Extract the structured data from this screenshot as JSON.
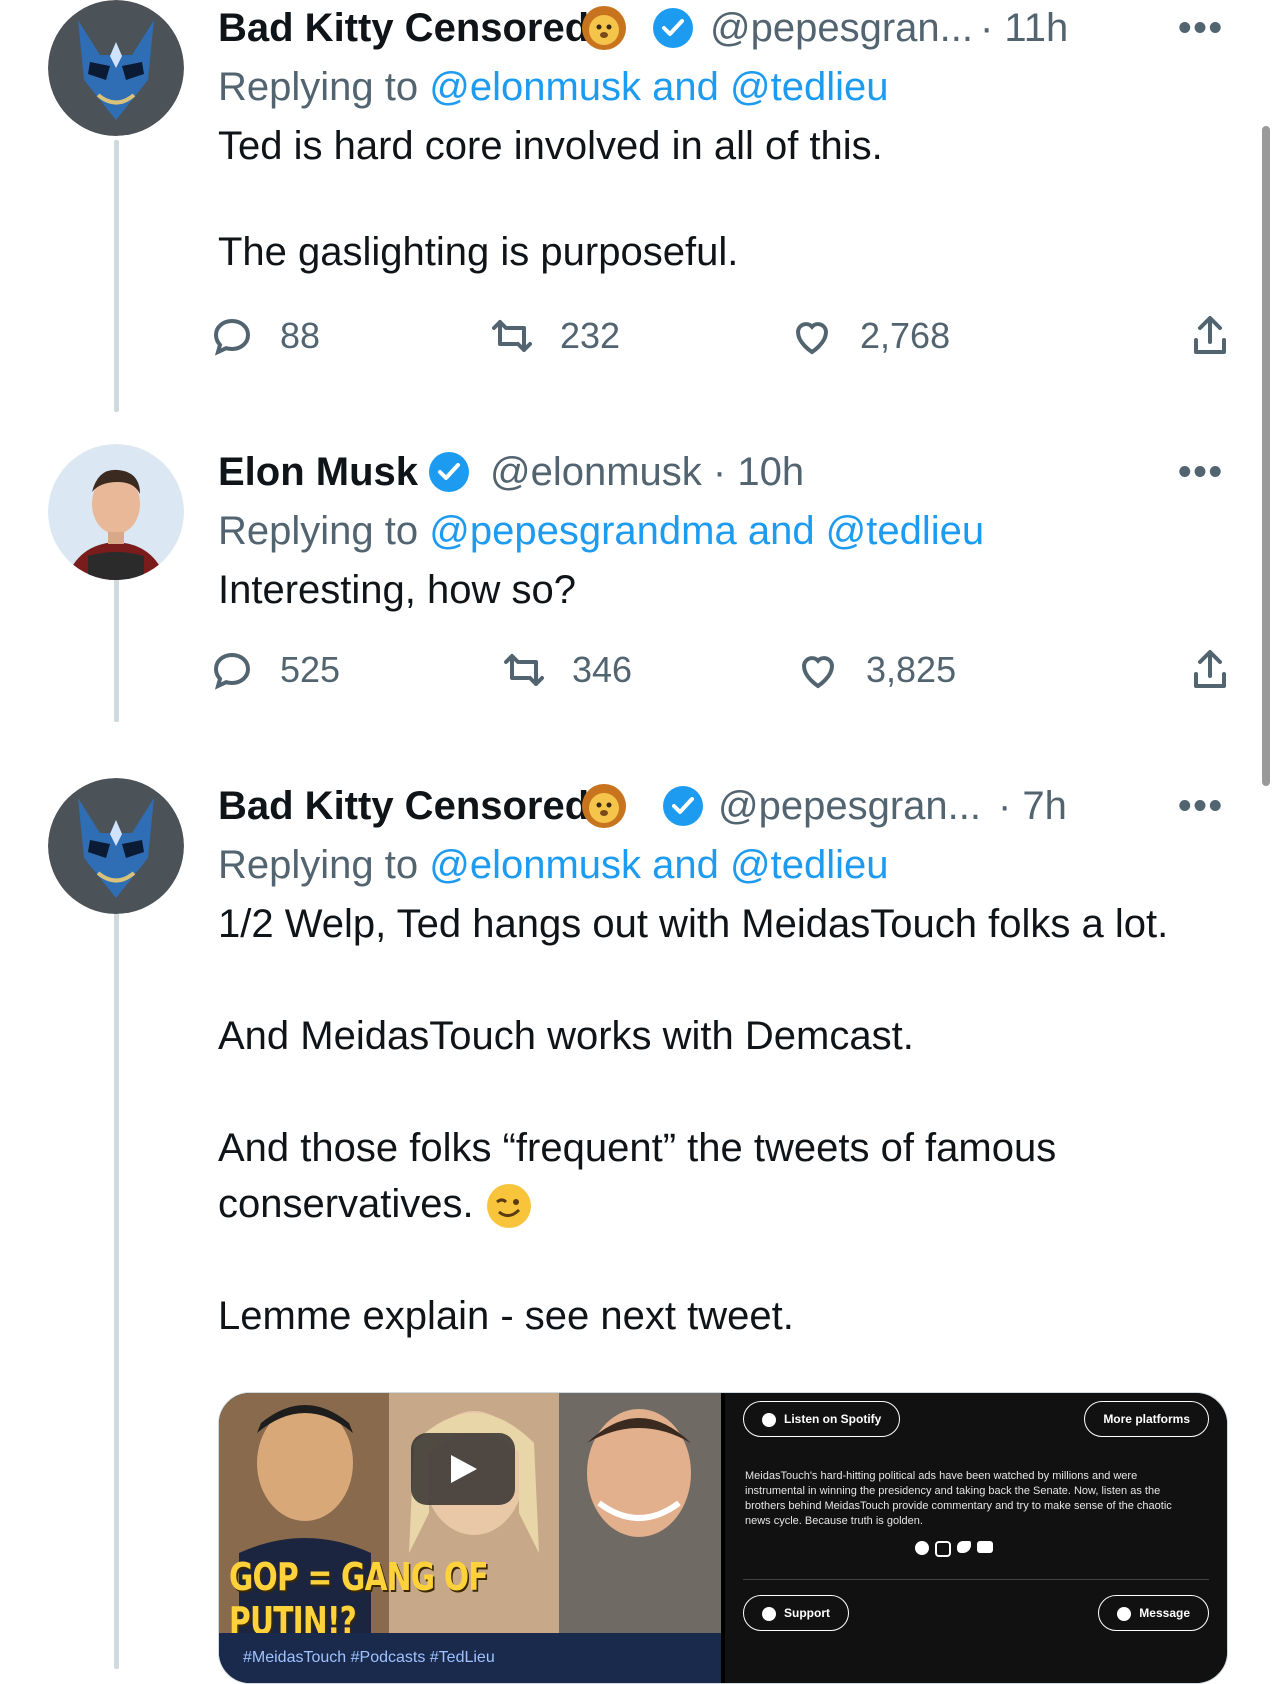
{
  "tweets": [
    {
      "name": "Bad Kitty Censored",
      "handle": "@pepesgran...",
      "time": "· 11h",
      "more": "•••",
      "replying_prefix": "Replying to",
      "replying_mentions": "@elonmusk and @tedlieu",
      "body": [
        "Ted is hard core involved in all of this.",
        "The gaslighting is purposeful."
      ],
      "replies": "88",
      "retweets": "232",
      "likes": "2,768"
    },
    {
      "name": "Elon Musk",
      "handle": "@elonmusk · 10h",
      "more": "•••",
      "replying_prefix": "Replying to",
      "replying_mentions": "@pepesgrandma and @tedlieu",
      "body": [
        "Interesting, how so?"
      ],
      "replies": "525",
      "retweets": "346",
      "likes": "3,825"
    },
    {
      "name": "Bad Kitty Censored",
      "handle": "@pepesgran...",
      "time": "· 7h",
      "more": "•••",
      "replying_prefix": "Replying to",
      "replying_mentions": "@elonmusk and @tedlieu",
      "body": [
        "1/2 Welp, Ted hangs out with MeidasTouch folks a lot.",
        "And MeidasTouch works with Demcast.",
        "And those folks “frequent” the tweets of famous conservatives. ",
        "Lemme explain - see next tweet."
      ]
    }
  ],
  "card": {
    "video_title": "GOP = GANG OF PUTIN!?",
    "tags": "#MeidasTouch   #Podcasts   #TedLieu",
    "listen": "Listen on Spotify",
    "more_platforms": "More platforms",
    "description": "MeidasTouch's hard-hitting political ads have been watched by millions and were instrumental in winning the presidency and taking back the Senate. Now, listen as the brothers behind MeidasTouch provide commentary and try to make sense of the chaotic news cycle. Because truth is golden.",
    "support": "Support",
    "message": "Message"
  },
  "colors": {
    "link": "#1d9bf0",
    "secondary": "#536471",
    "verified": "#1d9bf0"
  },
  "icons": [
    "reply-icon",
    "retweet-icon",
    "like-icon",
    "share-icon",
    "verified-badge-icon",
    "lion-emoji",
    "wink-emoji",
    "play-icon"
  ]
}
